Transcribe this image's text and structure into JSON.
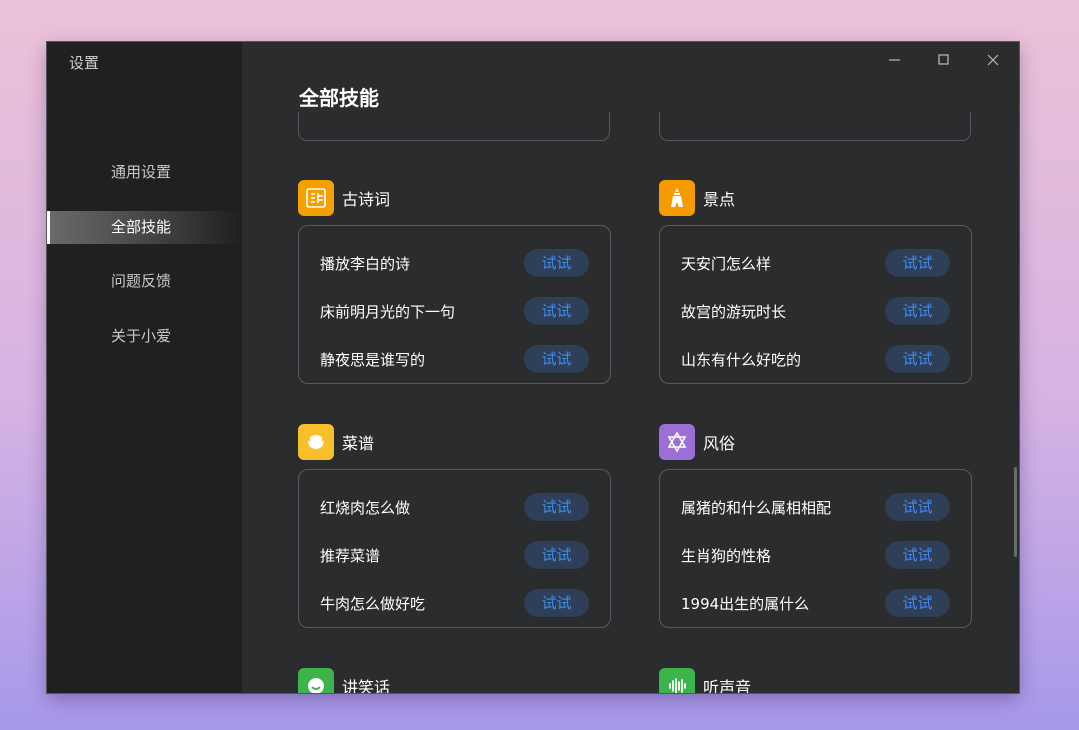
{
  "window": {
    "app_title": "设置",
    "page_title": "全部技能"
  },
  "sidebar": {
    "items": [
      {
        "label": "通用设置",
        "active": false
      },
      {
        "label": "全部技能",
        "active": true
      },
      {
        "label": "问题反馈",
        "active": false
      },
      {
        "label": "关于小爱",
        "active": false
      }
    ]
  },
  "categories": [
    {
      "title": "古诗词",
      "icon": "poetry-icon",
      "color": "#f5a000",
      "items": [
        {
          "text": "播放李白的诗",
          "button": "试试"
        },
        {
          "text": "床前明月光的下一句",
          "button": "试试"
        },
        {
          "text": "静夜思是谁写的",
          "button": "试试"
        }
      ]
    },
    {
      "title": "景点",
      "icon": "landmark-icon",
      "color": "#f59a00",
      "items": [
        {
          "text": "天安门怎么样",
          "button": "试试"
        },
        {
          "text": "故宫的游玩时长",
          "button": "试试"
        },
        {
          "text": "山东有什么好吃的",
          "button": "试试"
        }
      ]
    },
    {
      "title": "菜谱",
      "icon": "rice-bowl-icon",
      "color": "#f7c02a",
      "items": [
        {
          "text": "红烧肉怎么做",
          "button": "试试"
        },
        {
          "text": "推荐菜谱",
          "button": "试试"
        },
        {
          "text": "牛肉怎么做好吃",
          "button": "试试"
        }
      ]
    },
    {
      "title": "风俗",
      "icon": "star-of-david-icon",
      "color": "#9b6fd3",
      "items": [
        {
          "text": "属猪的和什么属相相配",
          "button": "试试"
        },
        {
          "text": "生肖狗的性格",
          "button": "试试"
        },
        {
          "text": "1994出生的属什么",
          "button": "试试"
        }
      ]
    },
    {
      "title": "讲笑话",
      "icon": "smile-icon",
      "color": "#3cb44a",
      "items": []
    },
    {
      "title": "听声音",
      "icon": "sound-wave-icon",
      "color": "#3cb44a",
      "items": []
    }
  ]
}
